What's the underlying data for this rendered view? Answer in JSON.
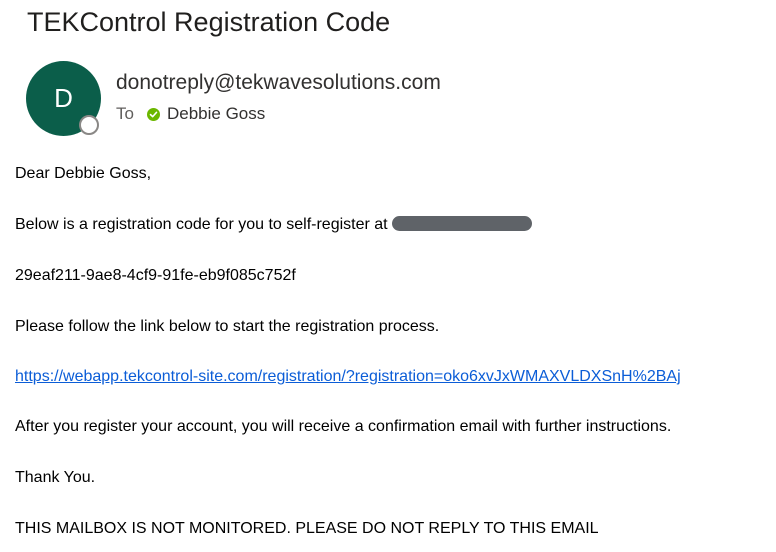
{
  "email": {
    "subject": "TEKControl Registration Code",
    "sender": {
      "initial": "D",
      "address": "donotreply@tekwavesolutions.com"
    },
    "to_label": "To",
    "recipient": "Debbie Goss",
    "body": {
      "greeting": "Dear Debbie Goss,",
      "intro": "Below is a registration code for you to self-register at",
      "code": "29eaf211-9ae8-4cf9-91fe-eb9f085c752f",
      "instruction": "Please follow the link below to start the registration process.",
      "link": "https://webapp.tekcontrol-site.com/registration/?registration=oko6xvJxWMAXVLDXSnH%2BAj",
      "followup": "After you register your account, you will receive a confirmation email with further instructions.",
      "thanks": "Thank You.",
      "footer": "THIS MAILBOX IS NOT MONITORED. PLEASE DO NOT REPLY TO THIS EMAIL"
    }
  },
  "colors": {
    "avatar": "#0b5e4a",
    "presence_available": "#6bb700",
    "link": "#0b5dd7",
    "redaction": "#5f6368"
  },
  "icons": {
    "presence": "status-ring-icon",
    "recipient_status": "available-check-icon"
  }
}
